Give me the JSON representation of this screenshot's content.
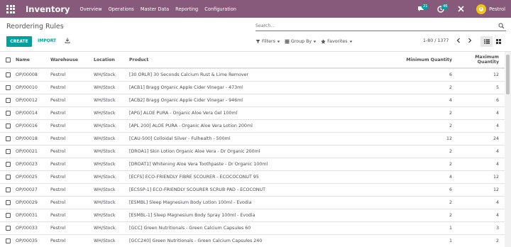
{
  "navbar": {
    "brand": "Inventory",
    "menu": [
      "Overview",
      "Operations",
      "Master Data",
      "Reporting",
      "Configuration"
    ],
    "chat_count": "21",
    "activity_count": "46",
    "user_initial": "P",
    "user_name": "Pestrol"
  },
  "page": {
    "title": "Reordering Rules",
    "create_label": "CREATE",
    "import_label": "IMPORT",
    "search_placeholder": "Search...",
    "filters_label": "Filters",
    "groupby_label": "Group By",
    "favorites_label": "Favorites",
    "pager": "1-80 / 1377"
  },
  "table": {
    "columns": [
      "Name",
      "Warehouse",
      "Location",
      "Product",
      "Minimum Quantity",
      "Maximum Quantity"
    ],
    "rows": [
      {
        "name": "OP/00008",
        "warehouse": "Pestrol",
        "location": "WH/Stock",
        "product": "[30 ORLR] 30 Seconds Calcium Rust & Lime Remover",
        "min": "6",
        "max": "12"
      },
      {
        "name": "OP/00010",
        "warehouse": "Pestrol",
        "location": "WH/Stock",
        "product": "[ACB1] Bragg Organic Apple Cider Vinegar - 473ml",
        "min": "2",
        "max": "5"
      },
      {
        "name": "OP/00012",
        "warehouse": "Pestrol",
        "location": "WH/Stock",
        "product": "[ACB2] Bragg Organic Apple Cider Vinegar - 946ml",
        "min": "4",
        "max": "6"
      },
      {
        "name": "OP/00014",
        "warehouse": "Pestrol",
        "location": "WH/Stock",
        "product": "[APG] ALOE PURA - Organic Aloe Vera Gel 100ml",
        "min": "2",
        "max": "4"
      },
      {
        "name": "OP/00016",
        "warehouse": "Pestrol",
        "location": "WH/Stock",
        "product": "[APL 200] ALOE PURA - Organic Aloe Vera Lotion 200ml",
        "min": "2",
        "max": "4"
      },
      {
        "name": "OP/00018",
        "warehouse": "Pestrol",
        "location": "WH/Stock",
        "product": "[CAU-500] Colloidal Silver - Fulhealth - 500ml",
        "min": "12",
        "max": "24"
      },
      {
        "name": "OP/00021",
        "warehouse": "Pestrol",
        "location": "WH/Stock",
        "product": "[DROA1] Skin Lotion Organic Aloe Vera - Dr Organic 200ml",
        "min": "2",
        "max": "4"
      },
      {
        "name": "OP/00023",
        "warehouse": "Pestrol",
        "location": "WH/Stock",
        "product": "[DROAT1] Whitening Aloe Vera Toothpaste - Dr Organic 100ml",
        "min": "2",
        "max": "4"
      },
      {
        "name": "OP/00025",
        "warehouse": "Pestrol",
        "location": "WH/Stock",
        "product": "[ECFS] ECO-FRIENDLY FIBRE SCOURER - ECOCOCONUT 95",
        "min": "4",
        "max": "12"
      },
      {
        "name": "OP/00027",
        "warehouse": "Pestrol",
        "location": "WH/Stock",
        "product": "[ECSSP-1] ECO-FRIENDLY SCOURER SCRUB PAD - ECOCONUT",
        "min": "6",
        "max": "12"
      },
      {
        "name": "OP/00029",
        "warehouse": "Pestrol",
        "location": "WH/Stock",
        "product": "[ESMBL] Sleep Magnesium Body Lotion 100ml - Evodia",
        "min": "2",
        "max": "4"
      },
      {
        "name": "OP/00031",
        "warehouse": "Pestrol",
        "location": "WH/Stock",
        "product": "[ESMBL-1] Sleep Magnesium Body Spray 100ml - Evodia",
        "min": "2",
        "max": "4"
      },
      {
        "name": "OP/00033",
        "warehouse": "Pestrol",
        "location": "WH/Stock",
        "product": "[GCC] Green Nutritionals - Green Calcium Capsules 60",
        "min": "1",
        "max": "3"
      },
      {
        "name": "OP/00035",
        "warehouse": "Pestrol",
        "location": "WH/Stock",
        "product": "[GCC240] Green Nutritionals - Green Calcium Capsules 240",
        "min": "1",
        "max": "2"
      }
    ]
  },
  "colors": {
    "navbar": "#875a7b",
    "primary": "#00a09d",
    "avatar": "#f0c419"
  }
}
